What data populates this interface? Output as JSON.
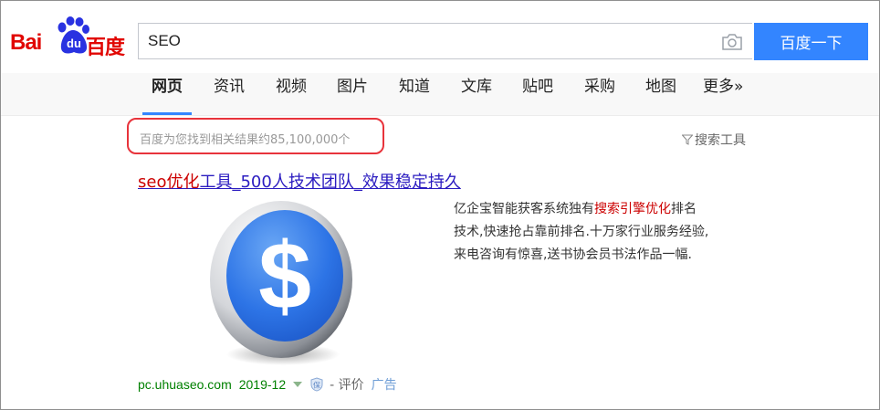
{
  "header": {
    "logo_latin": "Bai",
    "logo_du": "du",
    "logo_cn": "百度",
    "search_value": "SEO",
    "search_button": "百度一下"
  },
  "tabs": [
    {
      "label": "网页",
      "active": true
    },
    {
      "label": "资讯"
    },
    {
      "label": "视频"
    },
    {
      "label": "图片"
    },
    {
      "label": "知道"
    },
    {
      "label": "文库"
    },
    {
      "label": "贴吧"
    },
    {
      "label": "采购"
    },
    {
      "label": "地图"
    },
    {
      "label": "更多»"
    }
  ],
  "results_meta": {
    "count_text": "百度为您找到相关结果约85,100,000个",
    "tools_label": "搜索工具"
  },
  "result": {
    "title_highlight": "seo优化",
    "title_rest": "工具_500人技术团队_效果稳定持久",
    "desc_line1_pre": "亿企宝智能获客系统独有",
    "desc_line1_hl": "搜索引擎优化",
    "desc_line1_post": "排名",
    "desc_line2": "技术,快速抢占靠前排名.十万家行业服务经验,",
    "desc_line3": "来电咨询有惊喜,送书协会员书法作品一幅.",
    "url": "pc.uhuaseo.com",
    "date": "2019-12",
    "shield_glyph": "保",
    "rating": "- 评价",
    "ad": "广告"
  },
  "colors": {
    "brand_red": "#e10602",
    "search_blue": "#3385ff",
    "link_blue": "#2b1cc0",
    "highlight_red": "#cc0000",
    "url_green": "#008000",
    "box_red": "#e8333b"
  }
}
